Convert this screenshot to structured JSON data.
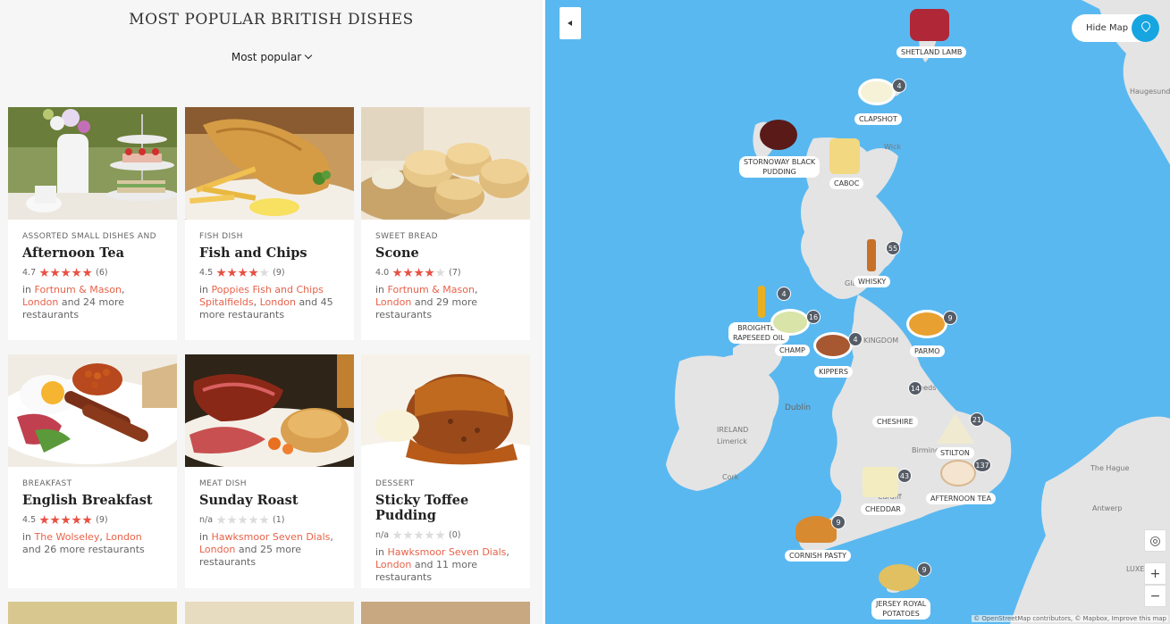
{
  "header": {
    "title": "MOST POPULAR BRITISH DISHES",
    "sort_label": "Most popular"
  },
  "cards": [
    {
      "category": "ASSORTED SMALL DISHES AND",
      "name": "Afternoon Tea",
      "rating": "4.7",
      "stars": 5,
      "count": "(6)",
      "prefix": "in ",
      "restaurant": "Fortnum & Mason",
      "city": "London",
      "more": "and 24 more restaurants",
      "sep": ", "
    },
    {
      "category": "FISH DISH",
      "name": "Fish and Chips",
      "rating": "4.5",
      "stars": 4,
      "count": "(9)",
      "prefix": "in ",
      "restaurant": "Poppies Fish and Chips Spitalfields",
      "city": "London",
      "more": "and 45 more restaurants",
      "sep": ", "
    },
    {
      "category": "SWEET BREAD",
      "name": "Scone",
      "rating": "4.0",
      "stars": 4,
      "count": "(7)",
      "prefix": "in ",
      "restaurant": "Fortnum & Mason",
      "city": "London",
      "more": "and 29 more restaurants",
      "sep": ", "
    },
    {
      "category": "BREAKFAST",
      "name": "English Breakfast",
      "rating": "4.5",
      "stars": 5,
      "count": "(9)",
      "prefix": "in ",
      "restaurant": "The Wolseley",
      "city": "London",
      "more": "and 26 more restaurants",
      "sep": ", "
    },
    {
      "category": "MEAT DISH",
      "name": "Sunday Roast",
      "rating": "n/a",
      "stars": 0,
      "count": "(1)",
      "prefix": "in ",
      "restaurant": "Hawksmoor Seven Dials",
      "city": "London",
      "more": "and 25 more restaurants",
      "sep": ", "
    },
    {
      "category": "DESSERT",
      "name": "Sticky Toffee Pudding",
      "rating": "n/a",
      "stars": 0,
      "count": "(0)",
      "prefix": "in ",
      "restaurant": "Hawksmoor Seven Dials",
      "city": "London",
      "more": "and 11 more restaurants",
      "sep": ", "
    }
  ],
  "map": {
    "hide_label": "Hide Map",
    "labels": {
      "shetland": "SHETLAND LAMB",
      "clapshot": "CLAPSHOT",
      "stornoway1": "STORNOWAY BLACK",
      "stornoway2": "PUDDING",
      "caboc": "CABOC",
      "whisky": "WHISKY",
      "broighter1": "BROIGHTER",
      "broighter2": "RAPESEED OIL",
      "champ": "CHAMP",
      "kippers": "KIPPERS",
      "parmo": "PARMO",
      "cheshire": "CHESHIRE",
      "stilton": "STILTON",
      "afternoon": "AFTERNOON TEA",
      "cheddar": "CHEDDAR",
      "cornish": "CORNISH PASTY",
      "jersey1": "JERSEY ROYAL",
      "jersey2": "POTATOES"
    },
    "counts": {
      "clapshot": "4",
      "whisky": "55",
      "broighter": "4",
      "champ": "16",
      "kippers": "4",
      "parmo": "9",
      "leeds": "14",
      "stilton": "21",
      "afternoon": "137",
      "cheddar": "43",
      "cornish": "9",
      "jersey": "9"
    },
    "places": {
      "wick": "Wick",
      "kingdom": "KINGDOM",
      "leeds": "Leeds",
      "dublin": "Dublin",
      "ireland": "IRELAND",
      "limerick": "Limerick",
      "cork": "Cork",
      "birming": "Birming",
      "hague": "The Hague",
      "antwerp": "Antwerp",
      "luxem": "LUXEM",
      "haugesund": "Haugesund",
      "glasgow": "Gla",
      "cardiff": "Cardiff"
    },
    "zoom_in": "+",
    "zoom_out": "−",
    "attribution": "© OpenStreetMap contributors, © Mapbox, Improve this map"
  }
}
